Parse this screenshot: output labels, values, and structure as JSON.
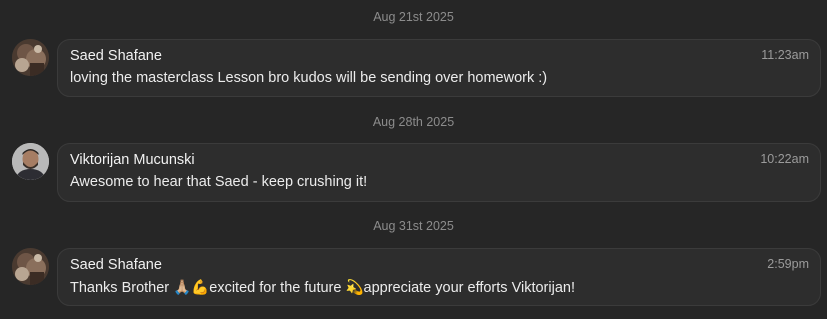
{
  "messages_thread": {
    "groups": [
      {
        "date": "Aug 21st 2025",
        "sender": "Saed Shafane",
        "time": "11:23am",
        "text": "loving the masterclass Lesson bro kudos will be sending over homework :)",
        "avatar_icon": "user-avatar-saed"
      },
      {
        "date": "Aug 28th 2025",
        "sender": "Viktorijan Mucunski",
        "time": "10:22am",
        "text": "Awesome to hear that Saed - keep crushing it!",
        "avatar_icon": "user-avatar-viktorijan"
      },
      {
        "date": "Aug 31st 2025",
        "sender": "Saed Shafane",
        "time": "2:59pm",
        "text": "Thanks Brother 🙏🏼💪excited for the future 💫appreciate your efforts Viktorijan!",
        "avatar_icon": "user-avatar-saed"
      }
    ]
  },
  "colors": {
    "background": "#262626",
    "bubble": "#2d2d2d",
    "bubble_border": "#3b3b3b",
    "date_text": "#8c8c8c",
    "timestamp_text": "#9b9b9b"
  }
}
